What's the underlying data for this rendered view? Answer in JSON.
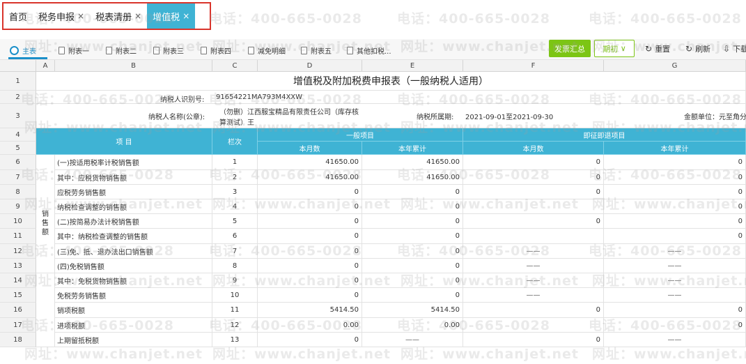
{
  "tabs": [
    {
      "label": "首页",
      "close": ""
    },
    {
      "label": "税务申报",
      "close": "×"
    },
    {
      "label": "税表清册",
      "close": "×"
    },
    {
      "label": "增值税",
      "close": "×"
    }
  ],
  "sheet_tabs": [
    "主表",
    "附表一",
    "附表二",
    "附表三",
    "附表四",
    "减免明细",
    "附表五",
    "其他扣税..."
  ],
  "toolbar": {
    "summary": "发票汇总",
    "period": "期初",
    "period_arrow": "∨",
    "reset": "重置",
    "reset_icon": "↻",
    "refresh": "刷新",
    "refresh_icon": "↻",
    "download": "下载",
    "download_icon": "⇩"
  },
  "columns": [
    "A",
    "B",
    "C",
    "D",
    "E",
    "F",
    "G"
  ],
  "rows": [
    "1",
    "2",
    "3",
    "4",
    "5",
    "6",
    "7",
    "8",
    "9",
    "10",
    "11",
    "12",
    "13",
    "14",
    "15",
    "16",
    "17",
    "18"
  ],
  "form": {
    "title": "增值税及附加税费申报表（一般纳税人适用）",
    "taxpayer_id_label": "纳税人识别号:",
    "taxpayer_id": "91654221MA793M4XXW",
    "taxpayer_name_label": "纳税人名称(公章):",
    "taxpayer_name_line1": "（勿删）江西服宝精品有限责任公司（库存核",
    "taxpayer_name_line2": "算测试）王",
    "period_label": "纳税所属期:",
    "period": "2021-09-01至2021-09-30",
    "unit": "金额单位：元至角分"
  },
  "headers": {
    "item": "项 目",
    "col": "栏次",
    "general": "一般项目",
    "refund": "即征即退项目",
    "month": "本月数",
    "year": "本年累计"
  },
  "category": "销售额",
  "lines": [
    {
      "item": "(一)按适用税率计税销售额",
      "no": "1",
      "d": "41650.00",
      "e": "41650.00",
      "f": "0",
      "g": "0"
    },
    {
      "item": "其中：应税货物销售额",
      "no": "2",
      "d": "41650.00",
      "e": "41650.00",
      "f": "0",
      "g": "0"
    },
    {
      "item": "应税劳务销售额",
      "no": "3",
      "d": "0",
      "e": "0",
      "f": "0",
      "g": "0"
    },
    {
      "item": "纳税检查调整的销售额",
      "no": "4",
      "d": "0",
      "e": "0",
      "f": "",
      "g": "0"
    },
    {
      "item": "(二)按简易办法计税销售额",
      "no": "5",
      "d": "0",
      "e": "0",
      "f": "0",
      "g": "0"
    },
    {
      "item": "其中：纳税检查调整的销售额",
      "no": "6",
      "d": "0",
      "e": "0",
      "f": "",
      "g": "0"
    },
    {
      "item": "(三)免、抵、退办法出口销售额",
      "no": "7",
      "d": "0",
      "e": "0",
      "f": "——",
      "g": "——"
    },
    {
      "item": "(四)免税销售额",
      "no": "8",
      "d": "0",
      "e": "0",
      "f": "——",
      "g": "——"
    },
    {
      "item": "其中：免税货物销售额",
      "no": "9",
      "d": "0",
      "e": "0",
      "f": "——",
      "g": "——"
    },
    {
      "item": "免税劳务销售额",
      "no": "10",
      "d": "0",
      "e": "0",
      "f": "——",
      "g": "——"
    },
    {
      "item": "销项税额",
      "no": "11",
      "d": "5414.50",
      "e": "5414.50",
      "f": "0",
      "g": "0"
    },
    {
      "item": "进项税额",
      "no": "12",
      "d": "0.00",
      "e": "0.00",
      "f": "",
      "g": "0"
    },
    {
      "item": "上期留抵税额",
      "no": "13",
      "d": "0",
      "e": "——",
      "f": "0",
      "g": "——"
    }
  ],
  "watermarks": {
    "phone": "电话：400-665-0028",
    "site": "网址：www.chanjet.net"
  }
}
